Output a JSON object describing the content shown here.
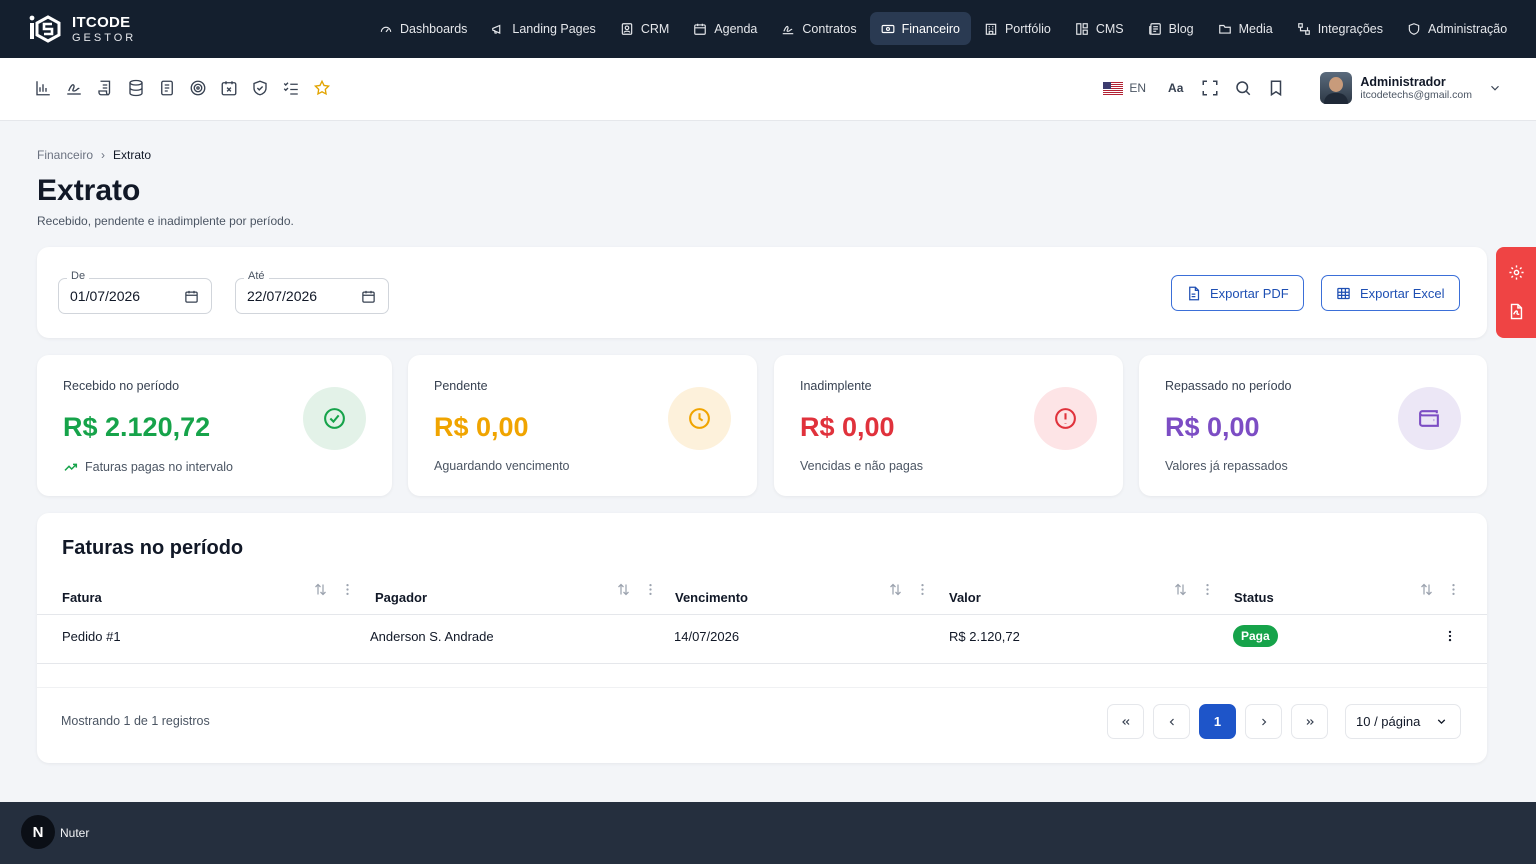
{
  "brand": {
    "title": "ITCODE",
    "subtitle": "GESTOR"
  },
  "nav": [
    {
      "label": "Dashboards",
      "icon": "gauge-icon"
    },
    {
      "label": "Landing Pages",
      "icon": "megaphone-icon"
    },
    {
      "label": "CRM",
      "icon": "contact-icon"
    },
    {
      "label": "Agenda",
      "icon": "calendar-icon"
    },
    {
      "label": "Contratos",
      "icon": "signature-icon"
    },
    {
      "label": "Financeiro",
      "icon": "money-icon",
      "active": true
    },
    {
      "label": "Portfólio",
      "icon": "building-icon"
    },
    {
      "label": "CMS",
      "icon": "layout-icon"
    },
    {
      "label": "Blog",
      "icon": "newspaper-icon"
    },
    {
      "label": "Media",
      "icon": "folder-icon"
    },
    {
      "label": "Integrações",
      "icon": "workflow-icon"
    },
    {
      "label": "Administração",
      "icon": "shield-icon"
    }
  ],
  "toolbar": {
    "icons": [
      "bar-chart-icon",
      "signature-icon",
      "scroll-icon",
      "database-icon",
      "receipt-icon",
      "target-icon",
      "calendar-x-icon",
      "shield-check-icon",
      "checklist-icon",
      "star-icon"
    ],
    "language": "EN",
    "font_size_label": "Aa",
    "user": {
      "name": "Administrador",
      "email": "itcodetechs@gmail.com"
    }
  },
  "breadcrumb": {
    "parent": "Financeiro",
    "separator": "›",
    "current": "Extrato"
  },
  "page": {
    "title": "Extrato",
    "subtitle": "Recebido, pendente e inadimplente por período."
  },
  "filters": {
    "from": {
      "label": "De",
      "value": "01/07/2026"
    },
    "to": {
      "label": "Até",
      "value": "22/07/2026"
    },
    "export_pdf": "Exportar PDF",
    "export_excel": "Exportar Excel"
  },
  "stats": [
    {
      "label": "Recebido no período",
      "value": "R$ 2.120,72",
      "note": "Faturas pagas no intervalo",
      "color": "#16a34a",
      "bg": "#e3f2e8",
      "icon": "check-circle-icon"
    },
    {
      "label": "Pendente",
      "value": "R$ 0,00",
      "note": "Aguardando vencimento",
      "color": "#f0a400",
      "bg": "#fdf1db",
      "icon": "clock-icon"
    },
    {
      "label": "Inadimplente",
      "value": "R$ 0,00",
      "note": "Vencidas e não pagas",
      "color": "#e0323c",
      "bg": "#fde4e6",
      "icon": "alert-circle-icon"
    },
    {
      "label": "Repassado no período",
      "value": "R$ 0,00",
      "note": "Valores já repassados",
      "color": "#7c4dc4",
      "bg": "#ece7f6",
      "icon": "wallet-icon"
    }
  ],
  "table": {
    "title": "Faturas no período",
    "columns": [
      "Fatura",
      "Pagador",
      "Vencimento",
      "Valor",
      "Status"
    ],
    "rows": [
      {
        "fatura": "Pedido #1",
        "pagador": "Anderson S. Andrade",
        "vencimento": "14/07/2026",
        "valor": "R$ 2.120,72",
        "status": "Paga"
      }
    ],
    "showing": "Mostrando 1 de 1 registros",
    "current_page": "1",
    "per_page": "10 / página"
  },
  "footer": {
    "badge": "N",
    "label": "Nuter"
  }
}
